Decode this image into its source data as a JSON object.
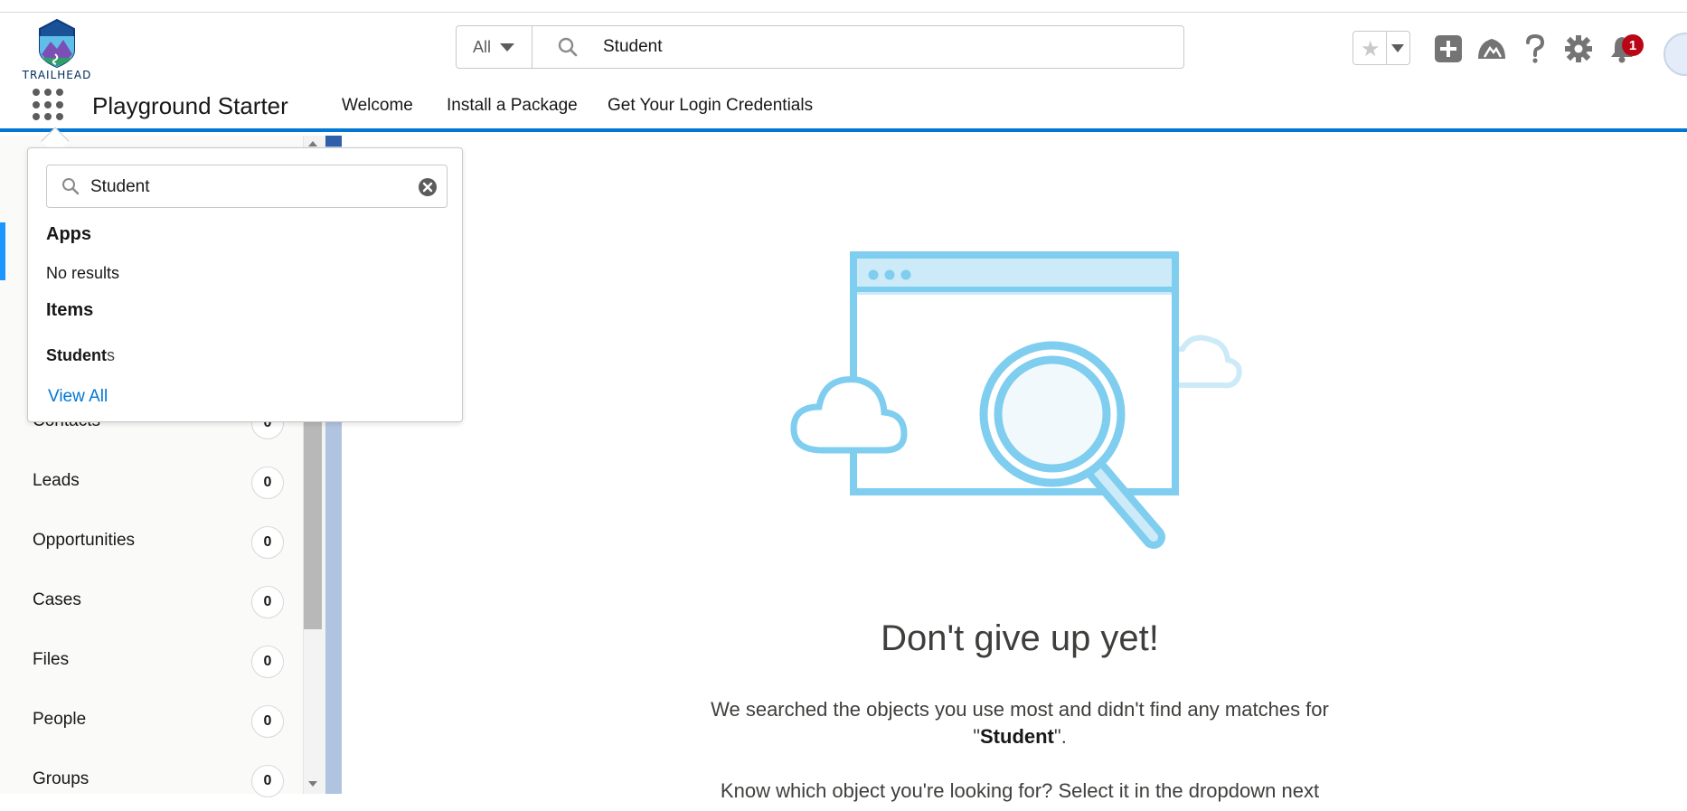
{
  "header": {
    "logo_text": "TRAILHEAD",
    "search_scope": "All",
    "search_value": "Student",
    "notification_count": "1"
  },
  "nav": {
    "app_name": "Playground Starter",
    "items": [
      "Welcome",
      "Install a Package",
      "Get Your Login Credentials"
    ]
  },
  "popover": {
    "search_value": "Student",
    "apps_heading": "Apps",
    "apps_empty": "No results",
    "items_heading": "Items",
    "item_match": "Student",
    "item_rest": "s",
    "view_all": "View All"
  },
  "objects": [
    {
      "label": "Contacts",
      "count": "0"
    },
    {
      "label": "Leads",
      "count": "0"
    },
    {
      "label": "Opportunities",
      "count": "0"
    },
    {
      "label": "Cases",
      "count": "0"
    },
    {
      "label": "Files",
      "count": "0"
    },
    {
      "label": "People",
      "count": "0"
    },
    {
      "label": "Groups",
      "count": "0"
    }
  ],
  "empty_state": {
    "title": "Don't give up yet!",
    "desc_before": "We searched the objects you use most and didn't find any matches for \"",
    "desc_term": "Student",
    "desc_after": "\".",
    "more": "Know which object you're looking for? Select it in the dropdown next"
  },
  "colors": {
    "brand_blue": "#0176d3",
    "illustration_blue": "#7fcdef",
    "badge_red": "#ba0517"
  },
  "icons": {
    "favorites": "star-icon",
    "add": "plus-icon",
    "trailhead": "trailhead-icon",
    "help": "help-icon",
    "setup": "gear-icon",
    "notifications": "bell-icon"
  }
}
